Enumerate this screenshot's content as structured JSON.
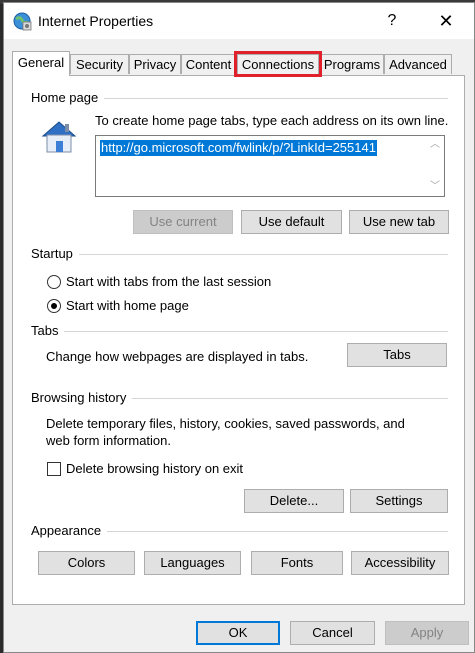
{
  "window": {
    "title": "Internet Properties",
    "help": "?",
    "close": "✕"
  },
  "tabs": [
    {
      "label": "General"
    },
    {
      "label": "Security"
    },
    {
      "label": "Privacy"
    },
    {
      "label": "Content"
    },
    {
      "label": "Connections"
    },
    {
      "label": "Programs"
    },
    {
      "label": "Advanced"
    }
  ],
  "home_page": {
    "group_label": "Home page",
    "description": "To create home page tabs, type each address on its own line.",
    "url": "http://go.microsoft.com/fwlink/p/?LinkId=255141",
    "use_current": "Use current",
    "use_default": "Use default",
    "use_new_tab": "Use new tab"
  },
  "startup": {
    "group_label": "Startup",
    "option_last_session": "Start with tabs from the last session",
    "option_home_page": "Start with home page"
  },
  "tabs_group": {
    "group_label": "Tabs",
    "description": "Change how webpages are displayed in tabs.",
    "button": "Tabs"
  },
  "browsing_history": {
    "group_label": "Browsing history",
    "description_line1": "Delete temporary files, history, cookies, saved passwords, and",
    "description_line2": "web form information.",
    "delete_on_exit": "Delete browsing history on exit",
    "delete_button": "Delete...",
    "settings_button": "Settings"
  },
  "appearance": {
    "group_label": "Appearance",
    "colors": "Colors",
    "languages": "Languages",
    "fonts": "Fonts",
    "accessibility": "Accessibility"
  },
  "footer": {
    "ok": "OK",
    "cancel": "Cancel",
    "apply": "Apply"
  }
}
